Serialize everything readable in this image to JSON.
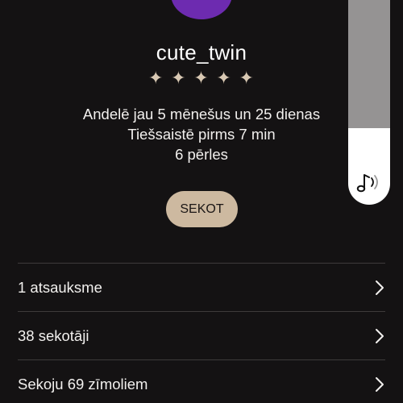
{
  "profile": {
    "username": "cute_twin",
    "rating_stars": [
      "✦",
      "✦",
      "✦",
      "✦",
      "✦"
    ],
    "on_site": "Andelē jau 5 mēnešus un 25 dienas",
    "last_online": "Tiešsaistē pirms 7 min",
    "pearls": "6 pērles"
  },
  "follow_button": {
    "label": "SEKOT"
  },
  "media_panel": {
    "level": 0.64,
    "icon": "music-note-sound-icon"
  },
  "list": [
    {
      "label": "1 atsauksme",
      "icon": "chevron-right-icon"
    },
    {
      "label": "38 sekotāji",
      "icon": "chevron-right-icon"
    },
    {
      "label": "Sekoju 69 zīmoliem",
      "icon": "chevron-right-icon"
    }
  ],
  "colors": {
    "background": "#141213",
    "avatar": "#6d2bb0",
    "follow_button": "#cdb9a0",
    "stars": "#d8c8b3"
  }
}
